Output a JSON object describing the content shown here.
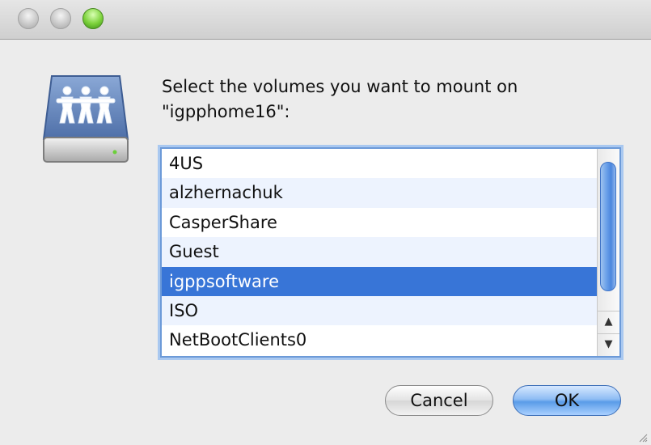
{
  "window": {
    "controls": {
      "close": "close-button",
      "minimize": "minimize-button",
      "zoom": "zoom-button"
    }
  },
  "dialog": {
    "prompt": "Select the volumes you want to mount on \"igpphome16\":",
    "icon": "network-drive-icon"
  },
  "volumes": {
    "items": [
      "4US",
      "alzhernachuk",
      "CasperShare",
      "Guest",
      "igppsoftware",
      "ISO",
      "NetBootClients0"
    ],
    "selected": "igppsoftware"
  },
  "buttons": {
    "cancel_label": "Cancel",
    "ok_label": "OK"
  },
  "colors": {
    "selection": "#3875d7",
    "alt_row": "#edf3fe",
    "focus_ring": "#6c9ad8"
  }
}
